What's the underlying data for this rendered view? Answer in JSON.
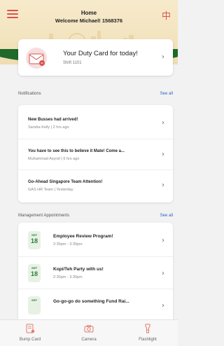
{
  "header": {
    "title": "Home",
    "welcome": "Welcome Michael! 1568376",
    "menu_icon": "hamburger-menu-icon",
    "language_icon": "chinese-language-icon",
    "language_glyph": "中",
    "accent_color": "#d9534f"
  },
  "duty_card": {
    "title": "Your Duty Card for today!",
    "shift": "Shift 1101",
    "icon": "duty-card-icon",
    "chevron": "›"
  },
  "notifications": {
    "section_title": "Notifications",
    "see_all": "See all",
    "items": [
      {
        "title": "New Busses had arrived!",
        "meta": "Sandra Kelly | 2 hrs ago"
      },
      {
        "title": "You have to see this to believe it Mate! Come a...",
        "meta": "Muhammad Asyraf | 6 hrs ago"
      },
      {
        "title": "Go-Ahead Singapore Team Attention!",
        "meta": "GAS HR Team | Yesterday"
      }
    ]
  },
  "appointments": {
    "section_title": "Management Appointments",
    "see_all": "See all",
    "items": [
      {
        "month": "SEP",
        "day": "18",
        "title": "Employee Review Program!",
        "time": "2:30pm - 3:30pm"
      },
      {
        "month": "SEP",
        "day": "18",
        "title": "Kopi/Teh Party with us!",
        "time": "2:30pm - 3:30pm"
      },
      {
        "month": "SEP",
        "day": "",
        "title": "Go-go-go do something Fund Rai...",
        "time": ""
      }
    ]
  },
  "bottom_nav": {
    "items": [
      {
        "label": "Bump Card",
        "icon": "bump-card-icon"
      },
      {
        "label": "Camera",
        "icon": "camera-icon"
      },
      {
        "label": "Flashlight",
        "icon": "flashlight-icon"
      }
    ]
  },
  "colors": {
    "header_bg": "#f3e4bf",
    "green_band": "#1f6a2b",
    "link_blue": "#2a62c9",
    "date_green": "#2f7d3a"
  }
}
